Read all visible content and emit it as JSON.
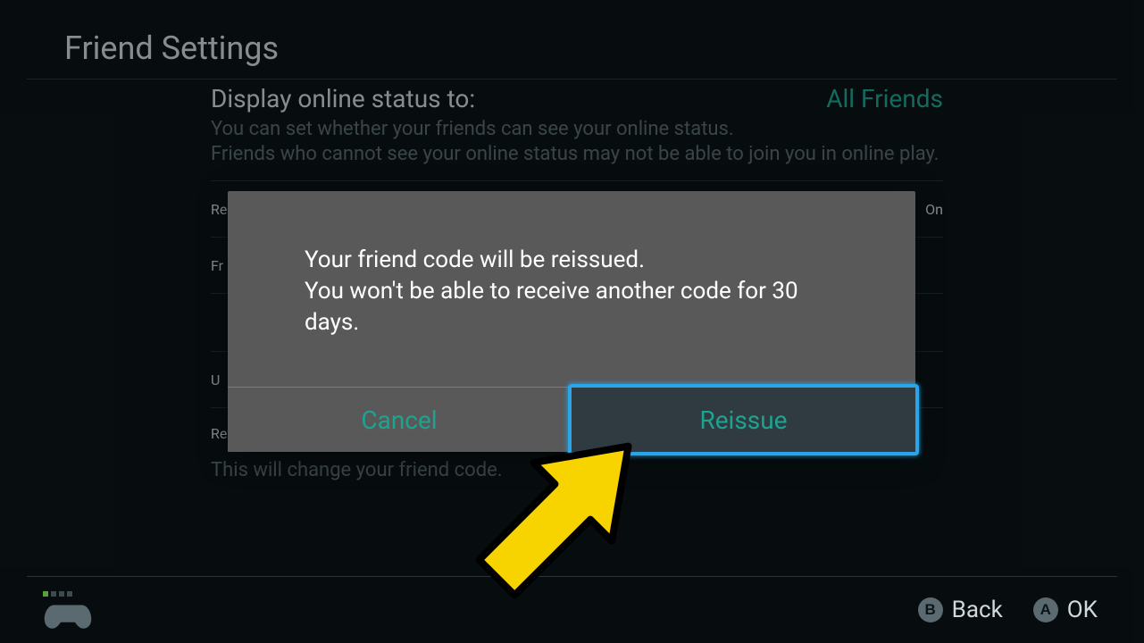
{
  "header": {
    "title": "Friend Settings"
  },
  "content": {
    "display_status": {
      "label": "Display online status to:",
      "value": "All Friends",
      "sub_line1": "You can set whether your friends can see your online status.",
      "sub_line2": "Friends who cannot see your online status may not be able to join you in online play."
    },
    "receive_row": {
      "label_prefix": "Re",
      "value": "On"
    },
    "friend_code_row": {
      "label_prefix": "Fr"
    },
    "util_row": {
      "label_prefix": "U"
    },
    "reissue": {
      "label": "Reissue Friend Code",
      "sub": "This will change your friend code."
    }
  },
  "dialog": {
    "line1": "Your friend code will be reissued.",
    "line2": "You won't be able to receive another code for 30 days.",
    "cancel": "Cancel",
    "confirm": "Reissue"
  },
  "footer": {
    "back_button_glyph": "B",
    "back_label": "Back",
    "ok_button_glyph": "A",
    "ok_label": "OK"
  }
}
